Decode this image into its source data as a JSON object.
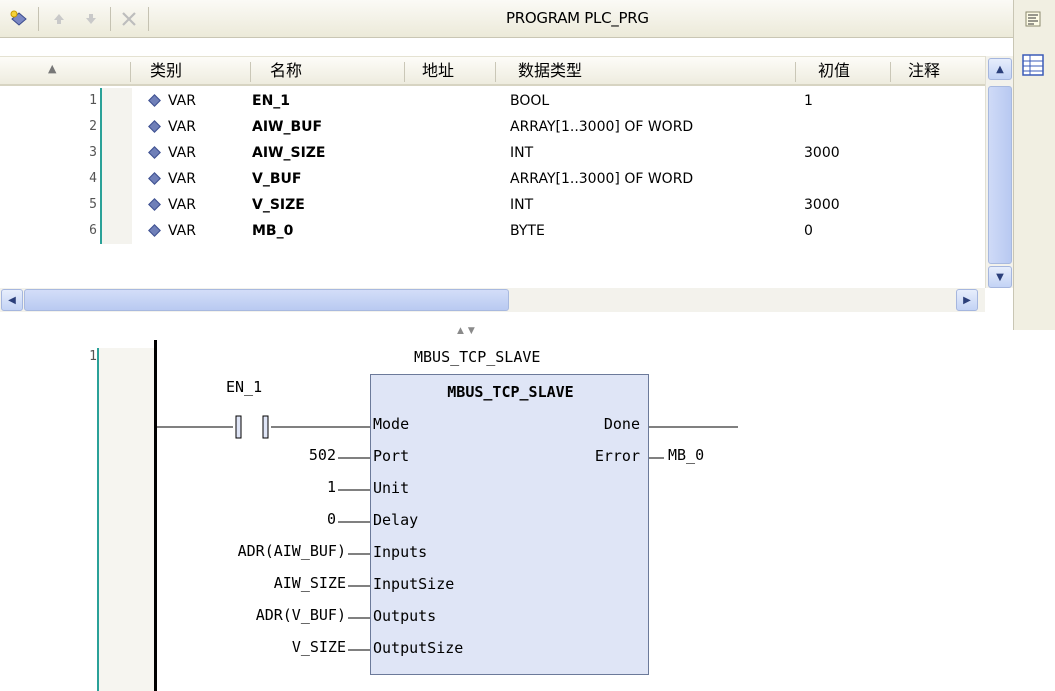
{
  "toolbar": {
    "title": "PROGRAM PLC_PRG",
    "buttons": [
      "new-variable-icon",
      "move-up-icon",
      "move-down-icon",
      "delete-icon"
    ]
  },
  "right_strip": {
    "buttons": [
      "text-view-icon",
      "table-view-icon"
    ]
  },
  "declarations": {
    "columns": [
      "类别",
      "名称",
      "地址",
      "数据类型",
      "初值",
      "注释"
    ],
    "rows": [
      {
        "num": "1",
        "kind": "VAR",
        "name": "EN_1",
        "address": "",
        "type": "BOOL",
        "init": "1",
        "comment": ""
      },
      {
        "num": "2",
        "kind": "VAR",
        "name": "AIW_BUF",
        "address": "",
        "type": "ARRAY[1..3000] OF WORD",
        "init": "",
        "comment": ""
      },
      {
        "num": "3",
        "kind": "VAR",
        "name": "AIW_SIZE",
        "address": "",
        "type": "INT",
        "init": "3000",
        "comment": ""
      },
      {
        "num": "4",
        "kind": "VAR",
        "name": "V_BUF",
        "address": "",
        "type": "ARRAY[1..3000] OF WORD",
        "init": "",
        "comment": ""
      },
      {
        "num": "5",
        "kind": "VAR",
        "name": "V_SIZE",
        "address": "",
        "type": "INT",
        "init": "3000",
        "comment": ""
      },
      {
        "num": "6",
        "kind": "VAR",
        "name": "MB_0",
        "address": "",
        "type": "BYTE",
        "init": "0",
        "comment": ""
      }
    ]
  },
  "ladder": {
    "network_number": "1",
    "instance_name": "MBUS_TCP_SLAVE",
    "block_type": "MBUS_TCP_SLAVE",
    "contact": "EN_1",
    "inputs": [
      {
        "pin": "Mode",
        "arg": ""
      },
      {
        "pin": "Port",
        "arg": "502"
      },
      {
        "pin": "Unit",
        "arg": "1"
      },
      {
        "pin": "Delay",
        "arg": "0"
      },
      {
        "pin": "Inputs",
        "arg": "ADR(AIW_BUF)"
      },
      {
        "pin": "InputSize",
        "arg": "AIW_SIZE"
      },
      {
        "pin": "Outputs",
        "arg": "ADR(V_BUF)"
      },
      {
        "pin": "OutputSize",
        "arg": "V_SIZE"
      }
    ],
    "outputs": [
      {
        "pin": "Done",
        "arg": ""
      },
      {
        "pin": "Error",
        "arg": "MB_0"
      }
    ]
  },
  "colors": {
    "line_marker": "#2aa198",
    "block_fill": "#dfe5f6",
    "scrollbar": "#c3d3f5"
  }
}
